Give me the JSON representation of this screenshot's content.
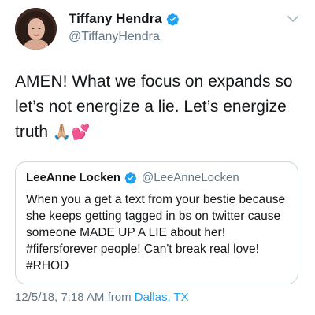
{
  "author": {
    "display_name": "Tiffany Hendra",
    "handle": "@TiffanyHendra",
    "verified": true
  },
  "tweet": {
    "text": "AMEN! What we focus on expands so let’s not energize a lie. Let’s energize truth",
    "emoji": "🙏🏼💕"
  },
  "quoted_tweet": {
    "display_name": "LeeAnne Locken",
    "handle": "@LeeAnneLocken",
    "verified": true,
    "text": "When you a get a text from your bestie because she keeps getting tagged in bs on twitter cause someone MADE UP A LIE about her! #fifersforever people! Can't break real love! #RHOD"
  },
  "meta": {
    "timestamp": "12/5/18, 7:18 AM",
    "from_word": "from",
    "location": "Dallas, TX"
  },
  "colors": {
    "verified_blue": "#1da1f2",
    "link_blue": "#1da1f2",
    "secondary_text": "#657786",
    "border": "#ccd6dd"
  },
  "icons": {
    "verified": "verified-badge-icon",
    "caret": "chevron-down-icon"
  }
}
